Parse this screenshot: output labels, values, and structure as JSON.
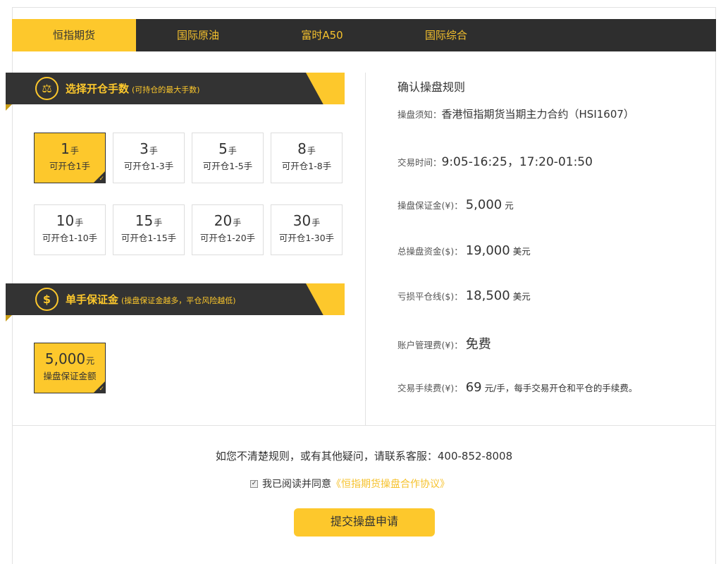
{
  "tabs": [
    {
      "label": "恒指期货"
    },
    {
      "label": "国际原油"
    },
    {
      "label": "富时A50"
    },
    {
      "label": "国际综合"
    }
  ],
  "section_lots": {
    "title": "选择开仓手数",
    "note": "(可持仓的最大手数)",
    "icon": "scale-icon",
    "options": [
      {
        "num": "1",
        "unit": "手",
        "sub": "可开仓1手"
      },
      {
        "num": "3",
        "unit": "手",
        "sub": "可开仓1-3手"
      },
      {
        "num": "5",
        "unit": "手",
        "sub": "可开仓1-5手"
      },
      {
        "num": "8",
        "unit": "手",
        "sub": "可开仓1-8手"
      },
      {
        "num": "10",
        "unit": "手",
        "sub": "可开仓1-10手"
      },
      {
        "num": "15",
        "unit": "手",
        "sub": "可开仓1-15手"
      },
      {
        "num": "20",
        "unit": "手",
        "sub": "可开仓1-20手"
      },
      {
        "num": "30",
        "unit": "手",
        "sub": "可开仓1-30手"
      }
    ]
  },
  "section_margin": {
    "title": "单手保证金",
    "note": "(操盘保证金越多，平仓风险越低)",
    "icon": "dollar-icon",
    "option": {
      "num": "5,000",
      "unit": "元",
      "sub": "操盘保证金额"
    }
  },
  "rules": {
    "title": "确认操盘规则",
    "notice_label": "操盘须知：",
    "notice_value": "香港恒指期货当期主力合约（HSI1607）",
    "time_label": "交易时间：",
    "time_value": "9:05-16:25，17:20-01:50",
    "margin_label": "操盘保证金(¥)：",
    "margin_value": "5,000",
    "margin_unit": "元",
    "total_label": "总操盘资金($)：",
    "total_value": "19,000",
    "total_unit": "美元",
    "stop_label": "亏损平仓线($)：",
    "stop_value": "18,500",
    "stop_unit": "美元",
    "fee_label": "账户管理费(¥)：",
    "fee_value": "免费",
    "commission_label": "交易手续费(¥)：",
    "commission_value": "69",
    "commission_unit": "元/手，每手交易开仓和平仓的手续费。"
  },
  "footer": {
    "contact": "如您不清楚规则，或有其他疑问，请联系客服：400-852-8008",
    "agree_text": "我已阅读并同意",
    "agree_link": "《恒指期货操盘合作协议》",
    "submit": "提交操盘申请"
  },
  "colors": {
    "accent": "#fdc82c",
    "dark": "#2e2e2e"
  }
}
